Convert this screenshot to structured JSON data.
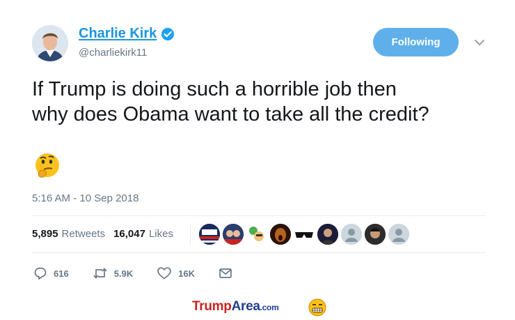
{
  "author": {
    "name": "Charlie Kirk",
    "handle": "@charliekirk11"
  },
  "follow_button": {
    "label": "Following"
  },
  "tweet": {
    "text_line1": "If Trump is doing such a horrible job then",
    "text_line2": "why does Obama want to take all the credit?",
    "emoji": "thinking-face",
    "timestamp": "5:16 AM - 10 Sep 2018"
  },
  "stats": {
    "retweets_count": "5,895",
    "retweets_label": "Retweets",
    "likes_count": "16,047",
    "likes_label": "Likes"
  },
  "actions": {
    "replies": "616",
    "retweets": "5.9K",
    "likes": "16K"
  },
  "footer": {
    "brand_trump": "Trump",
    "brand_area": "Area",
    "brand_tld": ".com"
  },
  "colors": {
    "accent": "#1b95e0",
    "follow_bg": "#5fb0ea",
    "muted": "#657786",
    "text": "#14171a"
  }
}
